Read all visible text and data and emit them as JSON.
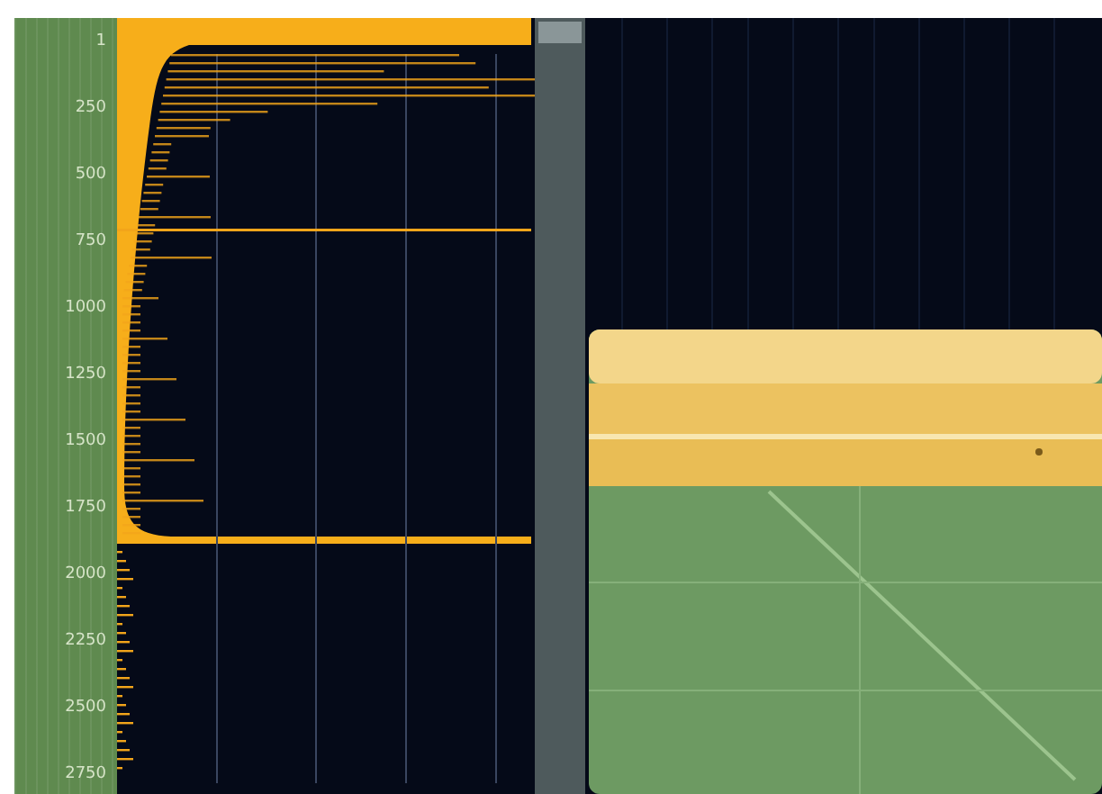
{
  "ruler": {
    "labels": [
      "1",
      "250",
      "500",
      "750",
      "1000",
      "1250",
      "1500",
      "1750",
      "2000",
      "2250",
      "2500",
      "2750"
    ]
  },
  "scrollbar": {
    "kind": "vertical"
  }
}
